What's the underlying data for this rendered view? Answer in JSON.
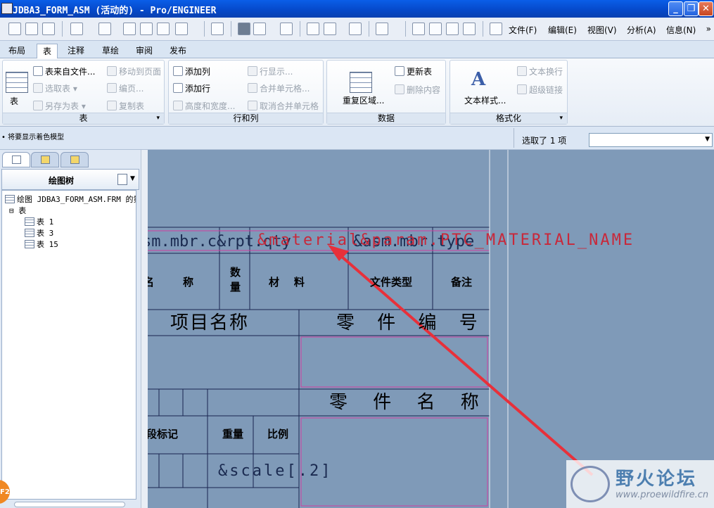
{
  "window": {
    "title": "JDBA3_FORM_ASM (活动的) - Pro/ENGINEER",
    "minimize": "_",
    "maximize": "❐",
    "close": "✕"
  },
  "menus": [
    {
      "label": "文件(F)"
    },
    {
      "label": "编辑(E)"
    },
    {
      "label": "视图(V)"
    },
    {
      "label": "分析(A)"
    },
    {
      "label": "信息(N)"
    }
  ],
  "menu_more": "»",
  "tabs": [
    "布局",
    "表",
    "注释",
    "草绘",
    "审阅",
    "发布"
  ],
  "active_tab": "表",
  "ribbon": {
    "group_table": {
      "label": "表",
      "big_button": "表",
      "buttons": [
        {
          "label": "表来自文件...",
          "enabled": true
        },
        {
          "label": "选取表",
          "enabled": false
        },
        {
          "label": "另存为表",
          "enabled": false
        },
        {
          "label": "移动到页面",
          "enabled": false
        },
        {
          "label": "编页...",
          "enabled": false
        },
        {
          "label": "复制表",
          "enabled": false
        }
      ]
    },
    "group_rows": {
      "label": "行和列",
      "buttons": [
        {
          "label": "添加列",
          "enabled": true
        },
        {
          "label": "添加行",
          "enabled": true
        },
        {
          "label": "高度和宽度...",
          "enabled": false
        },
        {
          "label": "行显示...",
          "enabled": false
        },
        {
          "label": "合并单元格...",
          "enabled": false
        },
        {
          "label": "取消合并单元格",
          "enabled": false
        }
      ]
    },
    "group_data": {
      "label": "数据",
      "big_button": "重复区域...",
      "buttons": [
        {
          "label": "更新表",
          "enabled": true
        },
        {
          "label": "删除内容",
          "enabled": false
        }
      ]
    },
    "group_format": {
      "label": "格式化",
      "big_button": "文本样式...",
      "buttons": [
        {
          "label": "文本换行",
          "enabled": false
        },
        {
          "label": "超级链接",
          "enabled": false
        }
      ]
    }
  },
  "status": {
    "message": "• 将要显示着色模型",
    "selection": "选取了 1 项",
    "filter_value": ""
  },
  "tree": {
    "title": "绘图树",
    "root": "绘图 JDBA3_FORM_ASM.FRM 的第",
    "branch": "表",
    "items": [
      "表 1",
      "表 3",
      "表 15"
    ]
  },
  "drawing": {
    "row_params": "sm.mbr.c&rpt.qty",
    "row_params2": "&asm.mbr.type",
    "red_param": "&material&param.PTC_MATERIAL_NAME",
    "headers": {
      "name_part": "称",
      "name_clip": "名",
      "qty": "数量",
      "material": "材    料",
      "filetype": "文件类型",
      "remark": "备注"
    },
    "project_name": "项目名称",
    "part_number": "零 件 编 号",
    "part_name": "零 件 名 称",
    "stage_mark": "段标记",
    "weight": "重量",
    "scale_label": "比例",
    "scale_param": "&scale[.2]"
  },
  "watermark": {
    "name": "野火论坛",
    "url": "www.proewildfire.cn"
  },
  "f2_badge": "F2",
  "colors": {
    "canvas": "#7f9ab8",
    "table_line": "#1a2450",
    "pink_line": "#d03fa0",
    "arrow": "#e8303a",
    "title_bar": "#0548c8"
  }
}
